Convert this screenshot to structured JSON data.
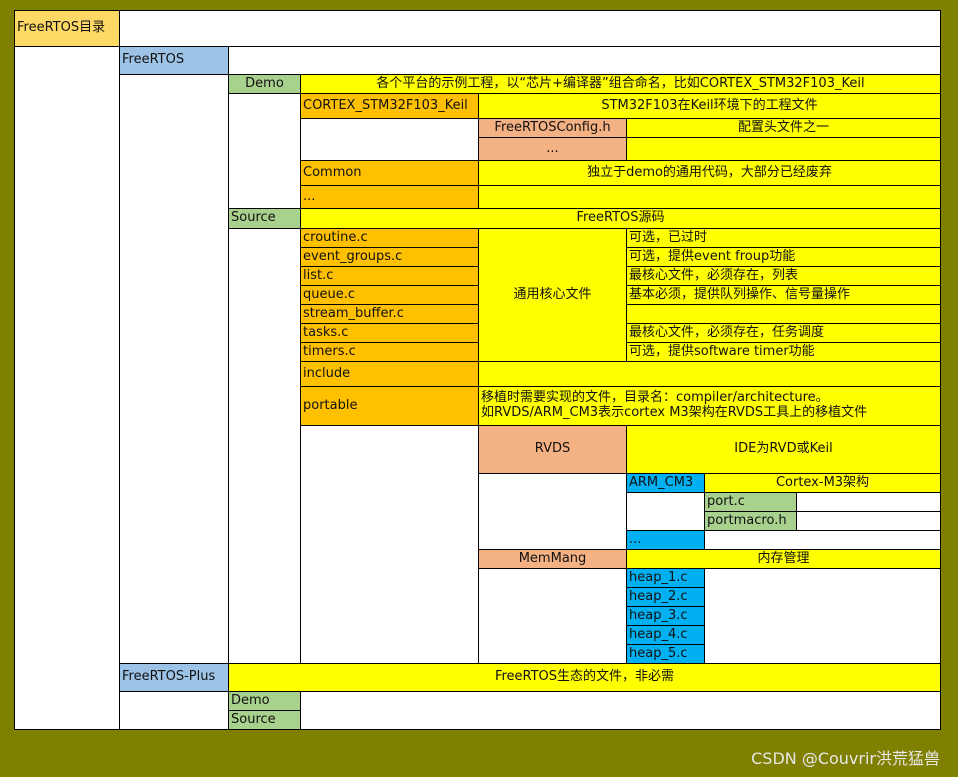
{
  "colors": {
    "background": "#7f7f00",
    "root": "#ffd966",
    "level1": "#9dc3e6",
    "level2": "#a9d18e",
    "level3": "#ffc000",
    "level4": "#f4b183",
    "level5": "#00b0f0",
    "note": "#ffff00",
    "empty": "#ffffff"
  },
  "watermark": "CSDN @Couvrir洪荒猛兽",
  "cells": [
    {
      "id": "r1",
      "text": "FreeRTOS目录",
      "color": "root",
      "align": "left"
    },
    {
      "id": "r2",
      "text": "",
      "color": "empty"
    },
    {
      "id": "r3",
      "text": "",
      "color": "empty"
    },
    {
      "id": "f1",
      "text": "FreeRTOS",
      "color": "level1",
      "align": "left"
    },
    {
      "id": "f2",
      "text": "",
      "color": "empty"
    },
    {
      "id": "f3",
      "text": "",
      "color": "empty"
    },
    {
      "id": "d1",
      "text": "Demo",
      "color": "level2",
      "align": "center"
    },
    {
      "id": "d2",
      "text": "各个平台的示例工程，以“芯片+编译器”组合命名，比如CORTEX_STM32F103_Keil",
      "color": "note",
      "align": "center"
    },
    {
      "id": "d3",
      "text": "",
      "color": "empty"
    },
    {
      "id": "k1",
      "text": "CORTEX_STM32F103_Keil",
      "color": "level3",
      "align": "left"
    },
    {
      "id": "k2",
      "text": "STM32F103在Keil环境下的工程文件",
      "color": "note",
      "align": "center"
    },
    {
      "id": "k3",
      "text": "",
      "color": "empty"
    },
    {
      "id": "k4",
      "text": "FreeRTOSConfig.h",
      "color": "level4",
      "align": "center"
    },
    {
      "id": "k5",
      "text": "配置头文件之一",
      "color": "note",
      "align": "center"
    },
    {
      "id": "k6",
      "text": "...",
      "color": "level4",
      "align": "center"
    },
    {
      "id": "k7",
      "text": "",
      "color": "note"
    },
    {
      "id": "c1",
      "text": "Common",
      "color": "level3",
      "align": "left"
    },
    {
      "id": "c2",
      "text": "独立于demo的通用代码，大部分已经废弃",
      "color": "note",
      "align": "center"
    },
    {
      "id": "c3",
      "text": "...",
      "color": "level3",
      "align": "left"
    },
    {
      "id": "c4",
      "text": "",
      "color": "note"
    },
    {
      "id": "s1",
      "text": "Source",
      "color": "level2",
      "align": "left"
    },
    {
      "id": "s2",
      "text": "FreeRTOS源码",
      "color": "note",
      "align": "center"
    },
    {
      "id": "s3",
      "text": "",
      "color": "empty"
    },
    {
      "id": "cr",
      "text": "croutine.c",
      "color": "level3",
      "align": "left"
    },
    {
      "id": "eg",
      "text": "event_groups.c",
      "color": "level3",
      "align": "left"
    },
    {
      "id": "li",
      "text": "list.c",
      "color": "level3",
      "align": "left"
    },
    {
      "id": "qu",
      "text": "queue.c",
      "color": "level3",
      "align": "left"
    },
    {
      "id": "sb",
      "text": "stream_buffer.c",
      "color": "level3",
      "align": "left"
    },
    {
      "id": "ta",
      "text": "tasks.c",
      "color": "level3",
      "align": "left"
    },
    {
      "id": "ti",
      "text": "timers.c",
      "color": "level3",
      "align": "left"
    },
    {
      "id": "core",
      "text": "通用核心文件",
      "color": "note",
      "align": "center"
    },
    {
      "id": "n1",
      "text": "可选，已过时",
      "color": "note",
      "align": "left"
    },
    {
      "id": "n2",
      "text": "可选，提供event froup功能",
      "color": "note",
      "align": "left"
    },
    {
      "id": "n3",
      "text": "最核心文件，必须存在，列表",
      "color": "note",
      "align": "left"
    },
    {
      "id": "n4",
      "text": "基本必须，提供队列操作、信号量操作",
      "color": "note",
      "align": "left"
    },
    {
      "id": "n5",
      "text": "",
      "color": "note"
    },
    {
      "id": "n6",
      "text": "最核心文件，必须存在，任务调度",
      "color": "note",
      "align": "left"
    },
    {
      "id": "n7",
      "text": "可选，提供software timer功能",
      "color": "note",
      "align": "left"
    },
    {
      "id": "in1",
      "text": "include",
      "color": "level3",
      "align": "left"
    },
    {
      "id": "in2",
      "text": "",
      "color": "note"
    },
    {
      "id": "po1",
      "text": "portable",
      "color": "level3",
      "align": "left"
    },
    {
      "id": "po2",
      "text": "移植时需要实现的文件，目录名：compiler/architecture。\n如RVDS/ARM_CM3表示cortex M3架构在RVDS工具上的移植文件",
      "color": "note",
      "align": "left",
      "multi": true
    },
    {
      "id": "po3",
      "text": "",
      "color": "empty"
    },
    {
      "id": "rv1",
      "text": "RVDS",
      "color": "level4",
      "align": "center"
    },
    {
      "id": "rv2",
      "text": "IDE为RVD或Keil",
      "color": "note",
      "align": "center"
    },
    {
      "id": "rv3",
      "text": "",
      "color": "empty"
    },
    {
      "id": "am1",
      "text": "ARM_CM3",
      "color": "level5",
      "align": "left"
    },
    {
      "id": "am2",
      "text": "Cortex-M3架构",
      "color": "note",
      "align": "center"
    },
    {
      "id": "am3",
      "text": "",
      "color": "empty"
    },
    {
      "id": "pc1",
      "text": "port.c",
      "color": "level2",
      "align": "left"
    },
    {
      "id": "pc2",
      "text": "",
      "color": "empty"
    },
    {
      "id": "pm1",
      "text": "portmacro.h",
      "color": "level2",
      "align": "left"
    },
    {
      "id": "pm2",
      "text": "",
      "color": "empty"
    },
    {
      "id": "dt1",
      "text": "...",
      "color": "level5",
      "align": "left"
    },
    {
      "id": "dt2",
      "text": "",
      "color": "empty"
    },
    {
      "id": "mm1",
      "text": "MemMang",
      "color": "level4",
      "align": "center"
    },
    {
      "id": "mm2",
      "text": "内存管理",
      "color": "note",
      "align": "center"
    },
    {
      "id": "mm3",
      "text": "",
      "color": "empty"
    },
    {
      "id": "h1",
      "text": "heap_1.c",
      "color": "level5",
      "align": "left"
    },
    {
      "id": "h2",
      "text": "heap_2.c",
      "color": "level5",
      "align": "left"
    },
    {
      "id": "h3",
      "text": "heap_3.c",
      "color": "level5",
      "align": "left"
    },
    {
      "id": "h4",
      "text": "heap_4.c",
      "color": "level5",
      "align": "left"
    },
    {
      "id": "h5",
      "text": "heap_5.c",
      "color": "level5",
      "align": "left"
    },
    {
      "id": "hx",
      "text": "",
      "color": "empty"
    },
    {
      "id": "pl1",
      "text": "FreeRTOS-Plus",
      "color": "level1",
      "align": "left"
    },
    {
      "id": "pl2",
      "text": "FreeRTOS生态的文件，非必需",
      "color": "note",
      "align": "center"
    },
    {
      "id": "pl3",
      "text": "",
      "color": "empty"
    },
    {
      "id": "pd1",
      "text": "Demo",
      "color": "level2",
      "align": "left"
    },
    {
      "id": "ps1",
      "text": "Source",
      "color": "level2",
      "align": "left"
    },
    {
      "id": "pd2",
      "text": "",
      "color": "empty"
    }
  ]
}
